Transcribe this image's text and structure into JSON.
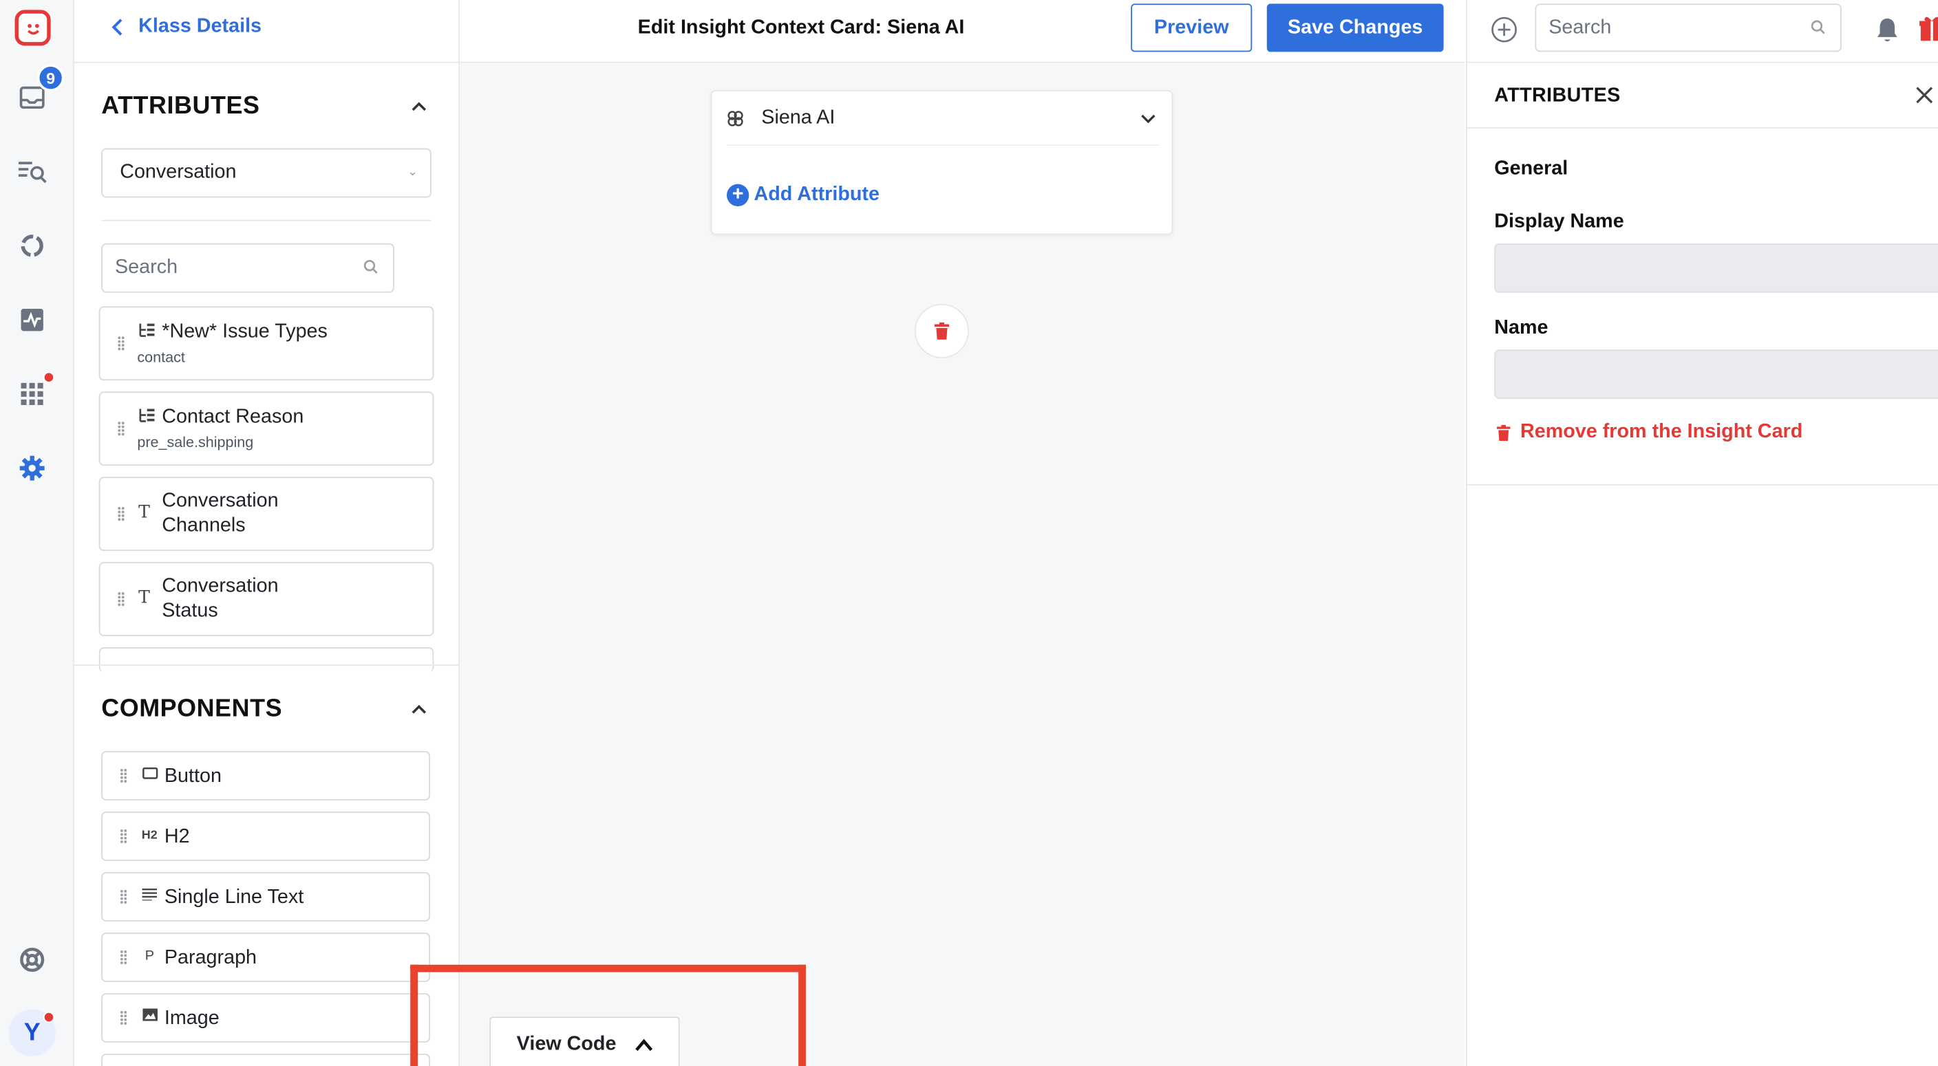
{
  "rail": {
    "inbox_badge": "9",
    "avatar_initial": "Y"
  },
  "left_panel": {
    "back_link": "Klass Details",
    "attributes": {
      "title": "ATTRIBUTES",
      "dropdown_value": "Conversation",
      "search_placeholder": "Search",
      "items": [
        {
          "icon": "tree-icon",
          "label": "*New* Issue Types",
          "sub": "contact"
        },
        {
          "icon": "tree-icon",
          "label": "Contact Reason",
          "sub": "pre_sale.shipping"
        },
        {
          "icon": "text-icon",
          "label": "Conversation Channels",
          "sub": ""
        },
        {
          "icon": "text-icon",
          "label": "Conversation Status",
          "sub": ""
        }
      ]
    },
    "components": {
      "title": "COMPONENTS",
      "items": [
        {
          "icon": "button-icon",
          "label": "Button"
        },
        {
          "icon": "h2-icon",
          "label": "H2"
        },
        {
          "icon": "lines-icon",
          "label": "Single Line Text"
        },
        {
          "icon": "paragraph-icon",
          "label": "Paragraph"
        },
        {
          "icon": "image-icon",
          "label": "Image"
        }
      ]
    }
  },
  "header": {
    "title": "Edit Insight Context Card: Siena AI",
    "preview_label": "Preview",
    "save_label": "Save Changes"
  },
  "canvas": {
    "card_title": "Siena AI",
    "add_attribute_label": "Add Attribute",
    "view_code_label": "View Code"
  },
  "right_top": {
    "search_placeholder": "Search"
  },
  "right_panel": {
    "title": "ATTRIBUTES",
    "section": "General",
    "display_name_label": "Display Name",
    "display_name_value": "",
    "name_label": "Name",
    "name_value": "",
    "remove_label": "Remove from the Insight Card"
  },
  "colors": {
    "accent": "#2f6fdb",
    "danger": "#e53935",
    "highlight": "#e8432c"
  }
}
